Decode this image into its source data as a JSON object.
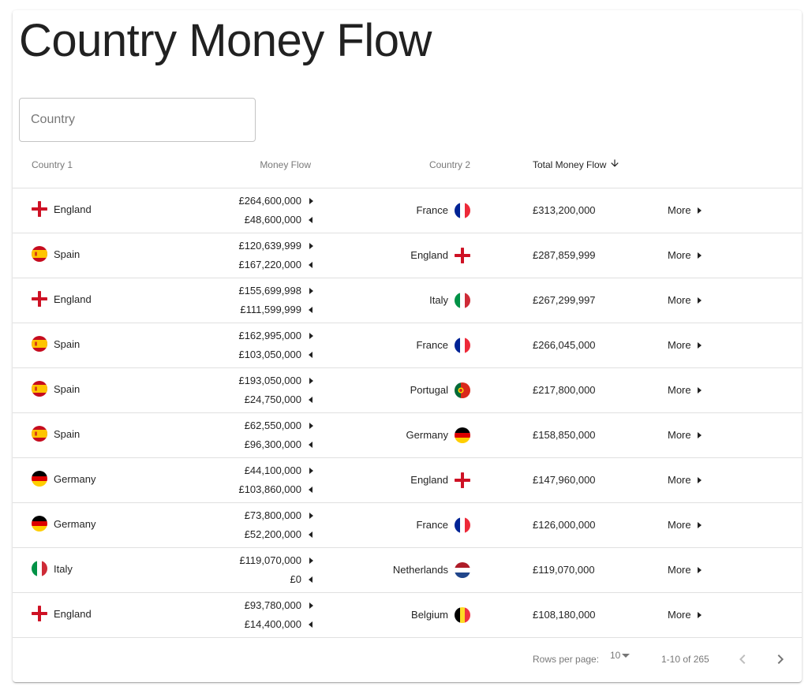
{
  "page": {
    "title": "Country Money Flow"
  },
  "filter": {
    "placeholder": "Country",
    "value": ""
  },
  "table": {
    "headers": {
      "country1": "Country 1",
      "money_flow": "Money Flow",
      "country2": "Country 2",
      "total": "Total Money Flow"
    },
    "sort": {
      "column": "total",
      "direction": "desc"
    },
    "rows": [
      {
        "country1": "England",
        "flag1": "england",
        "flow_out": "£264,600,000",
        "flow_in": "£48,600,000",
        "country2": "France",
        "flag2": "france",
        "total": "£313,200,000",
        "more": "More"
      },
      {
        "country1": "Spain",
        "flag1": "spain",
        "flow_out": "£120,639,999",
        "flow_in": "£167,220,000",
        "country2": "England",
        "flag2": "england",
        "total": "£287,859,999",
        "more": "More"
      },
      {
        "country1": "England",
        "flag1": "england",
        "flow_out": "£155,699,998",
        "flow_in": "£111,599,999",
        "country2": "Italy",
        "flag2": "italy",
        "total": "£267,299,997",
        "more": "More"
      },
      {
        "country1": "Spain",
        "flag1": "spain",
        "flow_out": "£162,995,000",
        "flow_in": "£103,050,000",
        "country2": "France",
        "flag2": "france",
        "total": "£266,045,000",
        "more": "More"
      },
      {
        "country1": "Spain",
        "flag1": "spain",
        "flow_out": "£193,050,000",
        "flow_in": "£24,750,000",
        "country2": "Portugal",
        "flag2": "portugal",
        "total": "£217,800,000",
        "more": "More"
      },
      {
        "country1": "Spain",
        "flag1": "spain",
        "flow_out": "£62,550,000",
        "flow_in": "£96,300,000",
        "country2": "Germany",
        "flag2": "germany",
        "total": "£158,850,000",
        "more": "More"
      },
      {
        "country1": "Germany",
        "flag1": "germany",
        "flow_out": "£44,100,000",
        "flow_in": "£103,860,000",
        "country2": "England",
        "flag2": "england",
        "total": "£147,960,000",
        "more": "More"
      },
      {
        "country1": "Germany",
        "flag1": "germany",
        "flow_out": "£73,800,000",
        "flow_in": "£52,200,000",
        "country2": "France",
        "flag2": "france",
        "total": "£126,000,000",
        "more": "More"
      },
      {
        "country1": "Italy",
        "flag1": "italy",
        "flow_out": "£119,070,000",
        "flow_in": "£0",
        "country2": "Netherlands",
        "flag2": "netherlands",
        "total": "£119,070,000",
        "more": "More"
      },
      {
        "country1": "England",
        "flag1": "england",
        "flow_out": "£93,780,000",
        "flow_in": "£14,400,000",
        "country2": "Belgium",
        "flag2": "belgium",
        "total": "£108,180,000",
        "more": "More"
      }
    ]
  },
  "pagination": {
    "rows_per_page_label": "Rows per page:",
    "rows_per_page": "10",
    "range": "1-10 of 265",
    "prev_icon": "chevron-left-icon",
    "next_icon": "chevron-right-icon"
  },
  "colors": {
    "text_primary": "#212121",
    "text_secondary": "#757575",
    "divider": "#e0e0e0"
  }
}
